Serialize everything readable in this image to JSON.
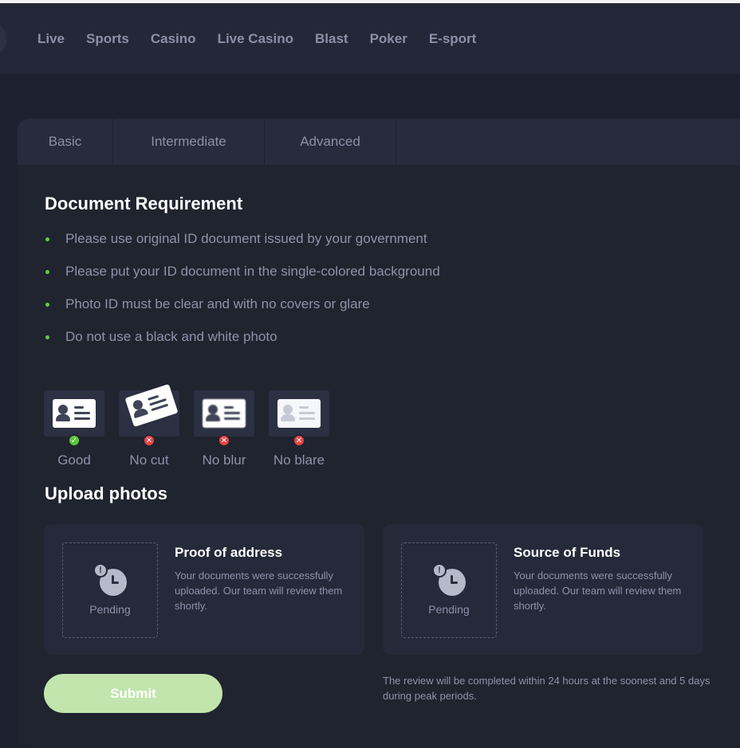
{
  "nav": {
    "items": [
      {
        "label": "Live"
      },
      {
        "label": "Sports"
      },
      {
        "label": "Casino"
      },
      {
        "label": "Live Casino"
      },
      {
        "label": "Blast"
      },
      {
        "label": "Poker"
      },
      {
        "label": "E-sport"
      }
    ]
  },
  "tabs": [
    {
      "label": "Basic"
    },
    {
      "label": "Intermediate"
    },
    {
      "label": "Advanced"
    }
  ],
  "requirements": {
    "title": "Document Requirement",
    "items": [
      "Please use original ID document issued by your government",
      "Please put your ID document in the single-colored background",
      "Photo ID must be clear and with no covers or glare",
      "Do not use a black and white photo"
    ]
  },
  "examples": [
    {
      "label": "Good",
      "status": "check-icon"
    },
    {
      "label": "No cut",
      "status": "x-icon"
    },
    {
      "label": "No blur",
      "status": "x-icon"
    },
    {
      "label": "No blare",
      "status": "x-icon"
    }
  ],
  "upload": {
    "title": "Upload photos",
    "cards": [
      {
        "title": "Proof of address",
        "status": "Pending",
        "text": "Your documents were successfully uploaded. Our team will review them shortly."
      },
      {
        "title": "Source of Funds",
        "status": "Pending",
        "text": "Your documents were successfully uploaded. Our team will review them shortly."
      }
    ],
    "submit_label": "Submit",
    "review_note": "The review will be completed within 24 hours at the soonest and 5 days during peak periods."
  },
  "colors": {
    "background": "#1e2230",
    "accent_green": "#6ac64e",
    "submit_disabled": "#c1e5ad",
    "error_red": "#e84444"
  }
}
